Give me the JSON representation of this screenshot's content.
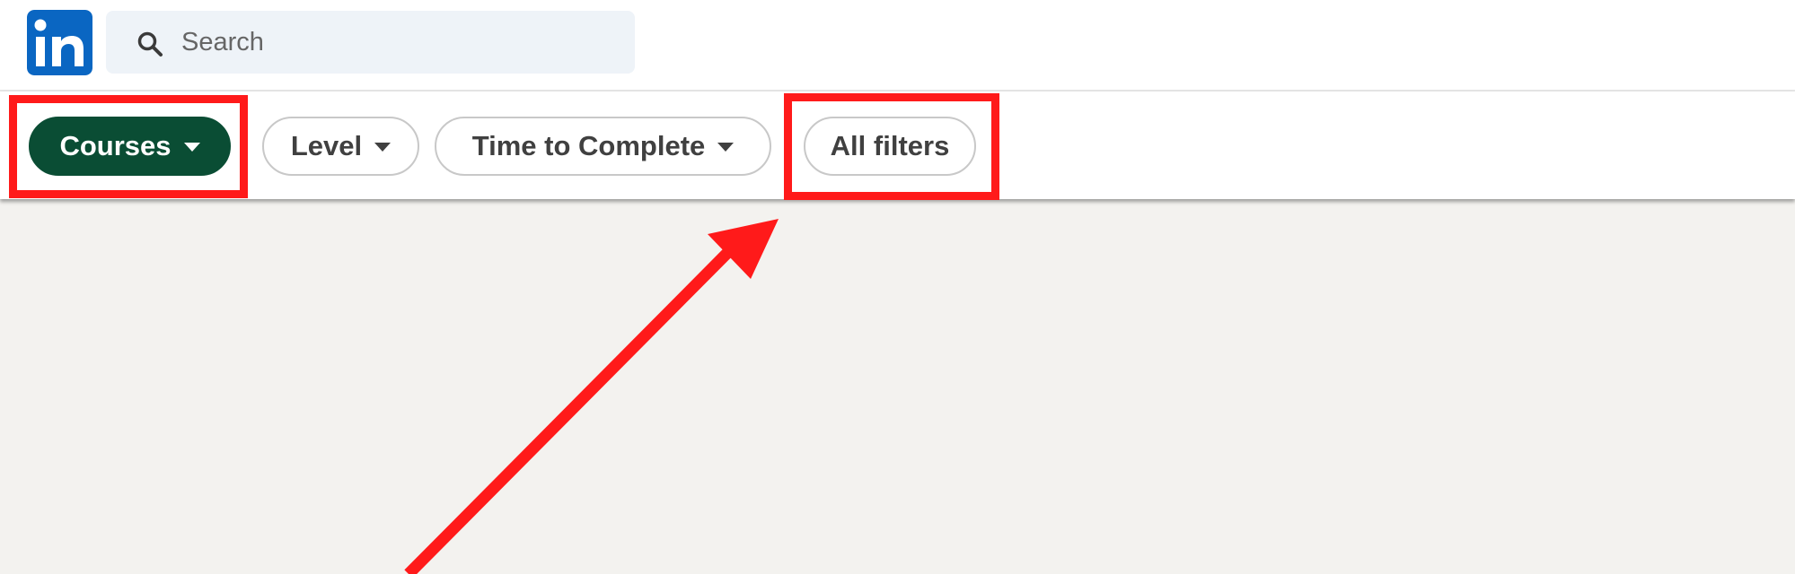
{
  "header": {
    "logo_text": "in",
    "search_placeholder": "Search"
  },
  "filters": [
    {
      "label": "Courses",
      "active": true,
      "has_dropdown": true
    },
    {
      "label": "Level",
      "active": false,
      "has_dropdown": true
    },
    {
      "label": "Time to Complete",
      "active": false,
      "has_dropdown": true
    },
    {
      "label": "All filters",
      "active": false,
      "has_dropdown": false
    }
  ],
  "colors": {
    "brand_blue": "#0a66c2",
    "active_pill": "#0a4d34",
    "annotation_red": "#ff1a1a",
    "page_background": "#f3f2ef"
  },
  "icons": {
    "logo": "linkedin-logo-icon",
    "search": "search-icon",
    "dropdown": "caret-down-icon",
    "annotation_arrow": "arrow-icon"
  }
}
